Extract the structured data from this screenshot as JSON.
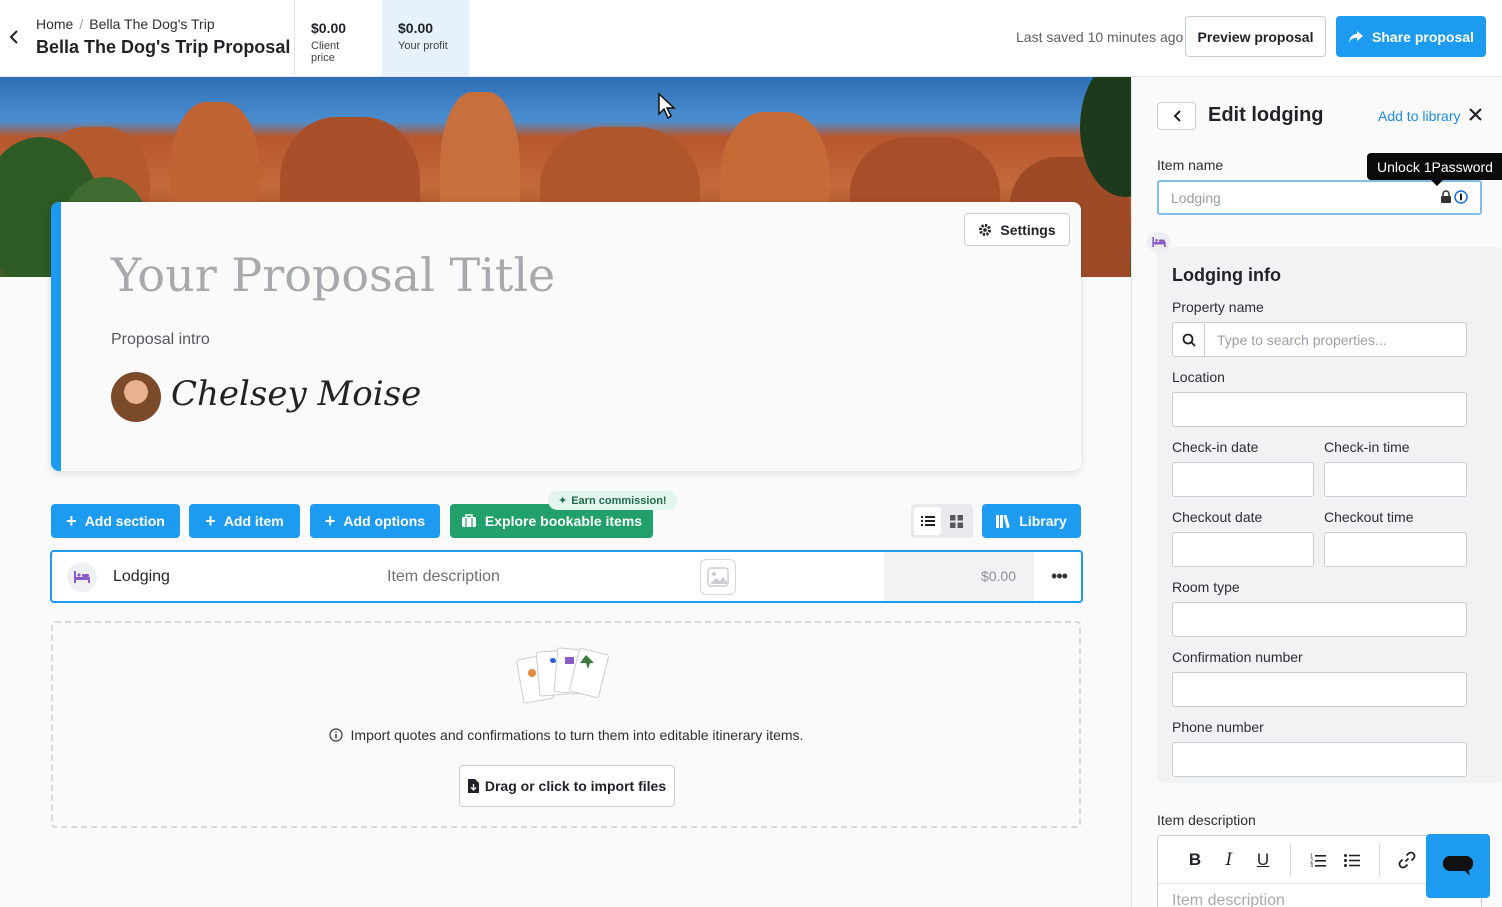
{
  "header": {
    "breadcrumb_home": "Home",
    "breadcrumb_separator": "/",
    "breadcrumb_trip": "Bella The Dog's Trip",
    "proposal_name": "Bella The Dog's Trip Proposal",
    "client_price_value": "$0.00",
    "client_price_label": "Client price",
    "profit_value": "$0.00",
    "profit_label": "Your profit",
    "last_saved": "Last saved 10 minutes ago",
    "preview_label": "Preview proposal",
    "share_label": "Share proposal"
  },
  "title_card": {
    "settings_label": "Settings",
    "title_placeholder": "Your Proposal Title",
    "intro_placeholder": "Proposal intro",
    "signature": "Chelsey Moise"
  },
  "toolbar": {
    "add_section": "Add section",
    "add_item": "Add item",
    "add_options": "Add options",
    "explore": "Explore bookable items",
    "earn_badge": "Earn commission!",
    "library": "Library"
  },
  "item_row": {
    "name": "Lodging",
    "description": "Item description",
    "price": "$0.00"
  },
  "import": {
    "text": "Import quotes and confirmations to turn them into editable itinerary items.",
    "button": "Drag or click to import files"
  },
  "panel": {
    "title": "Edit lodging",
    "add_to_library": "Add to library",
    "item_name_label": "Item name",
    "item_name_value": "Lodging",
    "tooltip": "Unlock 1Password",
    "lodging_info_title": "Lodging info",
    "property_name_label": "Property name",
    "property_search_placeholder": "Type to search properties...",
    "location_label": "Location",
    "checkin_date_label": "Check-in date",
    "checkin_time_label": "Check-in time",
    "checkout_date_label": "Checkout date",
    "checkout_time_label": "Checkout time",
    "room_type_label": "Room type",
    "confirmation_label": "Confirmation number",
    "phone_label": "Phone number",
    "item_description_label": "Item description",
    "item_description_placeholder": "Item description"
  },
  "colors": {
    "primary": "#1d9bf0",
    "success": "#22a06b",
    "profit_bg": "#e6f1fb"
  },
  "icons": [
    "chevron-left-icon",
    "share-icon",
    "gear-icon",
    "plus-icon",
    "suitcase-icon",
    "sparkle-icon",
    "list-view-icon",
    "grid-view-icon",
    "library-icon",
    "bed-icon",
    "image-icon",
    "more-icon",
    "info-icon",
    "file-icon",
    "close-icon",
    "lock-icon",
    "onepassword-icon",
    "search-icon",
    "bold-icon",
    "italic-icon",
    "underline-icon",
    "ordered-list-icon",
    "bullet-list-icon",
    "link-icon",
    "chat-icon",
    "cursor-icon"
  ]
}
